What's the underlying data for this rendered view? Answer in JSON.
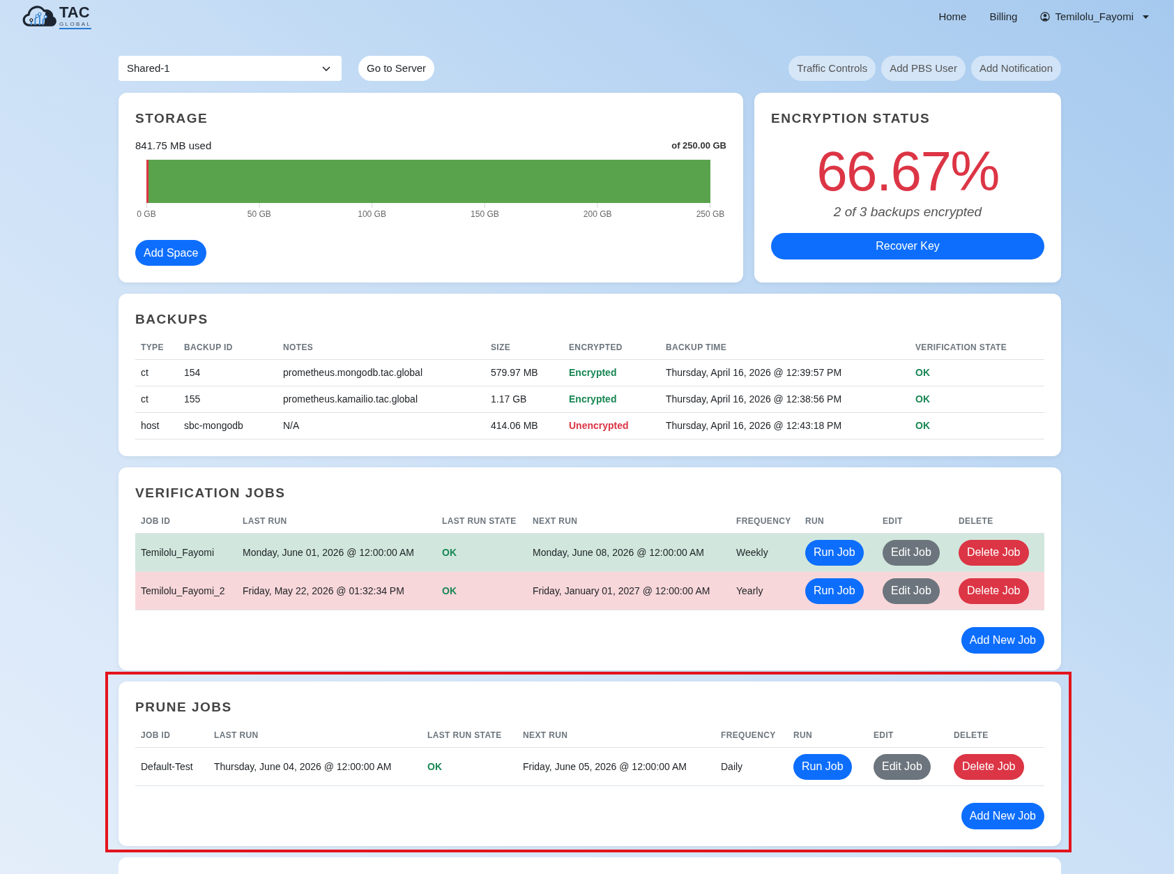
{
  "header": {
    "logo": {
      "name": "TAC",
      "tagline": "GLOBAL"
    },
    "nav": [
      {
        "label": "Home"
      },
      {
        "label": "Billing"
      }
    ],
    "user_menu": {
      "label": "Temilolu_Fayomi"
    }
  },
  "toolbar": {
    "server_select": {
      "value": "Shared-1"
    },
    "go_button": "Go to Server",
    "actions": [
      "Traffic Controls",
      "Add PBS User",
      "Add Notification"
    ]
  },
  "storage": {
    "title": "STORAGE",
    "used": "841.75 MB used",
    "total": "of 250.00 GB",
    "usage_meter": {
      "level": 0.0034,
      "ticks": [
        "0 GB",
        "50 GB",
        "100 GB",
        "150 GB",
        "200 GB",
        "250 GB"
      ]
    },
    "button": "Add Space"
  },
  "encryption": {
    "title": "ENCRYPTION STATUS",
    "percent": "66.67%",
    "summary": "2 of 3 backups encrypted",
    "button": "Recover Key"
  },
  "backups": {
    "title": "BACKUPS",
    "columns": [
      "TYPE",
      "BACKUP ID",
      "NOTES",
      "SIZE",
      "ENCRYPTED",
      "BACKUP TIME",
      "VERIFICATION STATE"
    ],
    "rows": [
      {
        "type": "ct",
        "backup_id": "154",
        "notes": "prometheus.mongodb.tac.global",
        "size": "579.97 MB",
        "encryption": "Encrypted",
        "encrypted": true,
        "backup_time": "Thursday, April 16, 2026 @ 12:39:57 PM",
        "verification_state": "OK",
        "verified": true
      },
      {
        "type": "ct",
        "backup_id": "155",
        "notes": "prometheus.kamailio.tac.global",
        "size": "1.17 GB",
        "encryption": "Encrypted",
        "encrypted": true,
        "backup_time": "Thursday, April 16, 2026 @ 12:38:56 PM",
        "verification_state": "OK",
        "verified": true
      },
      {
        "type": "host",
        "backup_id": "sbc-mongodb",
        "notes": "N/A",
        "size": "414.06 MB",
        "encryption": "Unencrypted",
        "encrypted": false,
        "backup_time": "Thursday, April 16, 2026 @ 12:43:18 PM",
        "verification_state": "OK",
        "verified": true
      }
    ]
  },
  "verification_jobs": {
    "title": "VERIFICATION JOBS",
    "columns": [
      "JOB ID",
      "LAST RUN",
      "LAST RUN STATE",
      "NEXT RUN",
      "FREQUENCY",
      "RUN",
      "EDIT",
      "DELETE"
    ],
    "rows": [
      {
        "job_id": "Temilolu_Fayomi",
        "last_run": "Monday, June 01, 2026 @ 12:00:00 AM",
        "last_run_state": "OK",
        "state_ok": true,
        "next_run": "Monday, June 08, 2026 @ 12:00:00 AM",
        "frequency": "Weekly",
        "color": "#d1e7dd",
        "actions": [
          {
            "label": "Run Job",
            "kind": "primary"
          },
          {
            "label": "Edit Job",
            "kind": "secondary"
          },
          {
            "label": "Delete Job",
            "kind": "danger"
          }
        ]
      },
      {
        "job_id": "Temilolu_Fayomi_2",
        "last_run": "Friday, May 22, 2026 @ 01:32:34 PM",
        "last_run_state": "OK",
        "state_ok": true,
        "next_run": "Friday, January 01, 2027 @ 12:00:00 AM",
        "frequency": "Yearly",
        "color": "#f8d7da",
        "actions": [
          {
            "label": "Run Job",
            "kind": "primary"
          },
          {
            "label": "Edit Job",
            "kind": "secondary"
          },
          {
            "label": "Delete Job",
            "kind": "danger"
          }
        ]
      }
    ],
    "add_button": "Add New Job"
  },
  "prune_jobs": {
    "title": "PRUNE JOBS",
    "highlighted": true,
    "columns": [
      "JOB ID",
      "LAST RUN",
      "LAST RUN STATE",
      "NEXT RUN",
      "FREQUENCY",
      "RUN",
      "EDIT",
      "DELETE"
    ],
    "rows": [
      {
        "job_id": "Default-Test",
        "last_run": "Thursday, June 04, 2026 @ 12:00:00 AM",
        "last_run_state": "OK",
        "state_ok": true,
        "next_run": "Friday, June 05, 2026 @ 12:00:00 AM",
        "frequency": "Daily",
        "actions": [
          {
            "label": "Run Job",
            "kind": "primary"
          },
          {
            "label": "Edit Job",
            "kind": "secondary"
          },
          {
            "label": "Delete Job",
            "kind": "danger"
          }
        ]
      }
    ],
    "add_button": "Add New Job"
  }
}
